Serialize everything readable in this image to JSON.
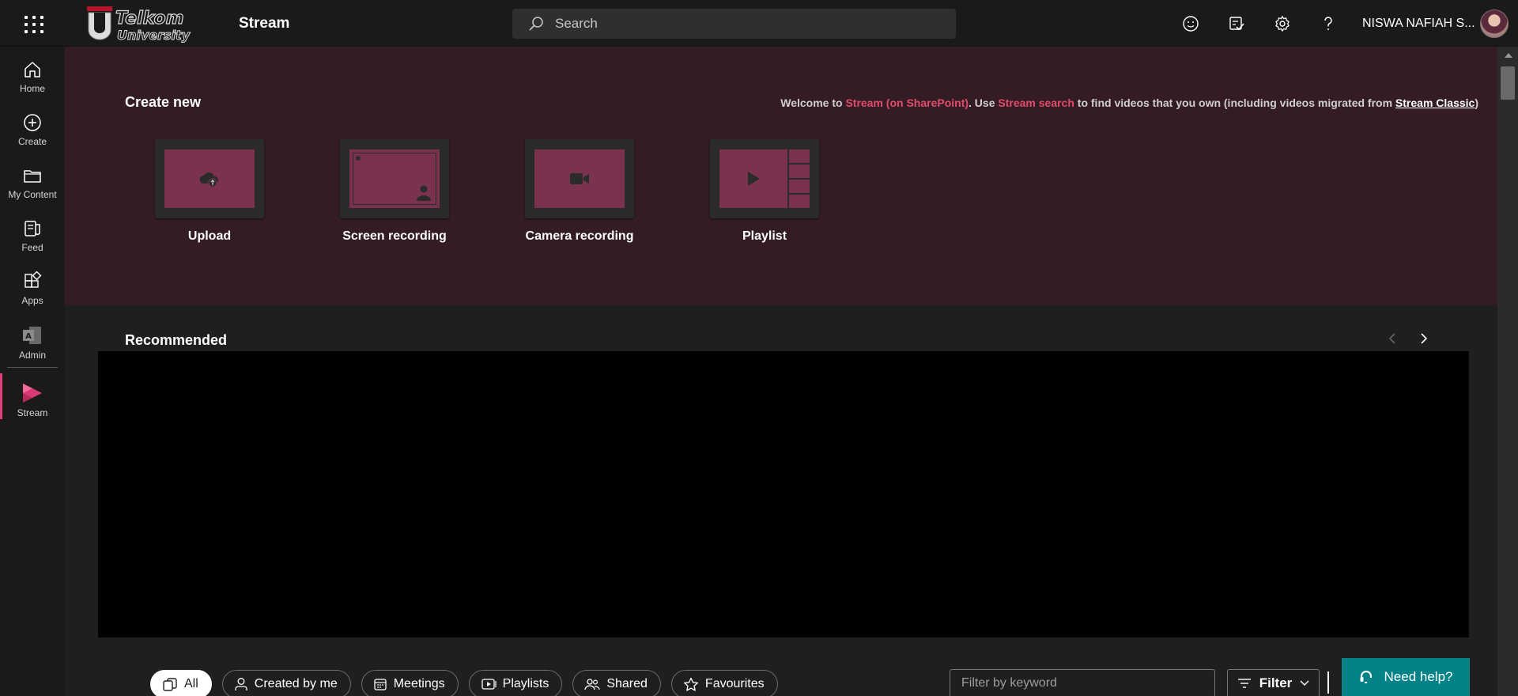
{
  "header": {
    "app_title": "Stream",
    "search_placeholder": "Search",
    "user_name": "NISWA NAFIAH S...",
    "logo_text_top": "Telkom",
    "logo_text_bottom": "University",
    "icons": [
      "app-launcher-icon",
      "feedback-smiley-icon",
      "tasks-icon",
      "settings-gear-icon",
      "help-question-icon"
    ]
  },
  "nav": {
    "items": [
      {
        "label": "Home",
        "icon": "home-icon"
      },
      {
        "label": "Create",
        "icon": "plus-circle-icon"
      },
      {
        "label": "My Content",
        "icon": "folder-icon"
      },
      {
        "label": "Feed",
        "icon": "feed-icon"
      },
      {
        "label": "Apps",
        "icon": "apps-icon"
      },
      {
        "label": "Admin",
        "icon": "admin-icon"
      },
      {
        "label": "Stream",
        "icon": "stream-logo-icon"
      }
    ],
    "active": "Stream"
  },
  "hero": {
    "title": "Create new",
    "welcome": {
      "part1": "Welcome to ",
      "link1": "Stream (on SharePoint)",
      "part2": ". Use ",
      "link2": "Stream search",
      "part3": " to find videos that you own (including videos migrated from ",
      "link3": "Stream Classic",
      "part4": ")"
    },
    "tiles": [
      {
        "label": "Upload",
        "icon": "cloud-upload-icon"
      },
      {
        "label": "Screen recording",
        "icon": "screen-recording-icon"
      },
      {
        "label": "Camera recording",
        "icon": "video-camera-icon"
      },
      {
        "label": "Playlist",
        "icon": "playlist-play-icon"
      }
    ]
  },
  "recommended": {
    "title": "Recommended"
  },
  "filters": {
    "pills": [
      {
        "label": "All",
        "icon": "all-icon",
        "active": true
      },
      {
        "label": "Created by me",
        "icon": "person-icon",
        "active": false
      },
      {
        "label": "Meetings",
        "icon": "calendar-icon",
        "active": false
      },
      {
        "label": "Playlists",
        "icon": "playlist-icon",
        "active": false
      },
      {
        "label": "Shared",
        "icon": "people-icon",
        "active": false
      },
      {
        "label": "Favourites",
        "icon": "star-icon",
        "active": false
      }
    ],
    "keyword_placeholder": "Filter by keyword",
    "filter_label": "Filter",
    "help_label": "Need help?"
  },
  "colors": {
    "accent_pink": "#e14c6c",
    "tile_fill": "#7b324f",
    "hero_bg": "#331c24",
    "help_teal": "#038387"
  }
}
